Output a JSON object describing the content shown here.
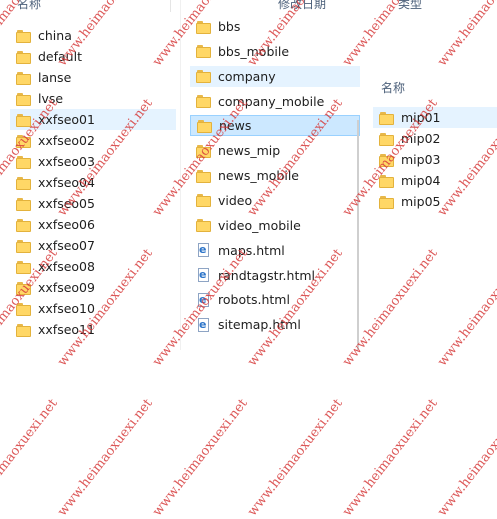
{
  "left_panel": {
    "header": "名称",
    "items": [
      {
        "label": "china",
        "icon": "folder-icon"
      },
      {
        "label": "default",
        "icon": "folder-icon"
      },
      {
        "label": "lanse",
        "icon": "folder-icon"
      },
      {
        "label": "lvse",
        "icon": "folder-icon"
      },
      {
        "label": "xxfseo01",
        "icon": "folder-icon",
        "state": "hover"
      },
      {
        "label": "xxfseo02",
        "icon": "folder-icon"
      },
      {
        "label": "xxfseo03",
        "icon": "folder-icon"
      },
      {
        "label": "xxfseo04",
        "icon": "folder-icon"
      },
      {
        "label": "xxfseo05",
        "icon": "folder-icon"
      },
      {
        "label": "xxfseo06",
        "icon": "folder-icon"
      },
      {
        "label": "xxfseo07",
        "icon": "folder-icon"
      },
      {
        "label": "xxfseo08",
        "icon": "folder-icon"
      },
      {
        "label": "xxfseo09",
        "icon": "folder-icon"
      },
      {
        "label": "xxfseo10",
        "icon": "folder-icon"
      },
      {
        "label": "xxfseo11",
        "icon": "folder-icon"
      }
    ]
  },
  "middle_panel": {
    "header": "修改日期",
    "items": [
      {
        "label": "bbs",
        "icon": "folder-icon"
      },
      {
        "label": "bbs_mobile",
        "icon": "folder-icon"
      },
      {
        "label": "company",
        "icon": "folder-icon",
        "state": "hover"
      },
      {
        "label": "company_mobile",
        "icon": "folder-icon"
      },
      {
        "label": "news",
        "icon": "folder-icon",
        "state": "selected"
      },
      {
        "label": "news_mip",
        "icon": "folder-icon"
      },
      {
        "label": "news_mobile",
        "icon": "folder-icon"
      },
      {
        "label": "video",
        "icon": "folder-icon"
      },
      {
        "label": "video_mobile",
        "icon": "folder-icon"
      },
      {
        "label": "maps.html",
        "icon": "html-file-icon"
      },
      {
        "label": "randtagstr.html",
        "icon": "html-file-icon"
      },
      {
        "label": "robots.html",
        "icon": "html-file-icon"
      },
      {
        "label": "sitemap.html",
        "icon": "html-file-icon"
      }
    ]
  },
  "right_panel": {
    "header_type": "类型",
    "header_name": "名称",
    "items": [
      {
        "label": "mip01",
        "icon": "folder-icon",
        "state": "hover"
      },
      {
        "label": "mip02",
        "icon": "folder-icon"
      },
      {
        "label": "mip03",
        "icon": "folder-icon"
      },
      {
        "label": "mip04",
        "icon": "folder-icon"
      },
      {
        "label": "mip05",
        "icon": "folder-icon"
      }
    ]
  },
  "watermark": "www.heimaoxuexi.net",
  "colors": {
    "selected_bg": "#cce8ff",
    "hover_bg": "#e5f3ff",
    "folder": "#ffd766",
    "watermark": "#d63a3a"
  }
}
